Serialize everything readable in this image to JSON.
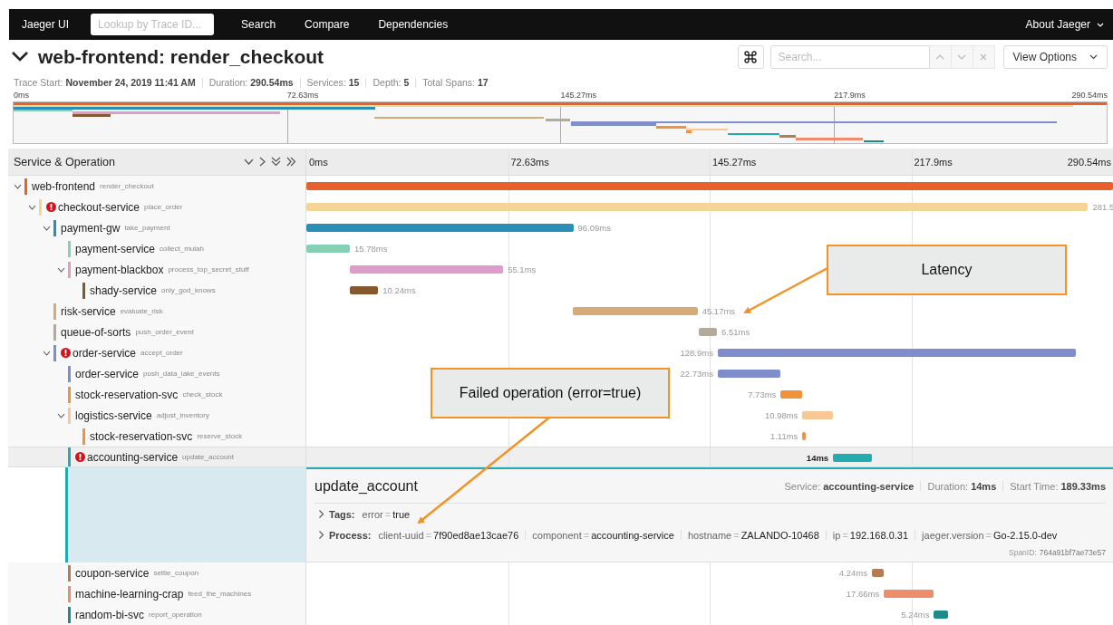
{
  "nav": {
    "brand": "Jaeger UI",
    "lookup_placeholder": "Lookup by Trace ID...",
    "links": [
      "Search",
      "Compare",
      "Dependencies"
    ],
    "about": "About Jaeger"
  },
  "trace": {
    "title": "web-frontend: render_checkout",
    "expanded": true,
    "search_placeholder": "Search...",
    "view_options": "View Options",
    "meta": [
      {
        "label": "Trace Start:",
        "value": "November 24, 2019 11:41 AM"
      },
      {
        "label": "Duration:",
        "value": "290.54ms"
      },
      {
        "label": "Services:",
        "value": "15"
      },
      {
        "label": "Depth:",
        "value": "5"
      },
      {
        "label": "Total Spans:",
        "value": "17"
      }
    ]
  },
  "minimap_ticks": [
    "0ms",
    "72.63ms",
    "145.27ms",
    "217.9ms",
    "290.54ms"
  ],
  "header": {
    "title": "Service & Operation",
    "ticks": [
      "0ms",
      "72.63ms",
      "145.27ms",
      "217.9ms",
      "290.54ms"
    ]
  },
  "spans": [
    {
      "service": "web-frontend",
      "operation": "render_checkout",
      "color": "#e8612c",
      "error": false,
      "expanded": true,
      "selected": false,
      "children": [
        {
          "service": "checkout-service",
          "operation": "place_order",
          "color": "#f5d597",
          "error": true,
          "expanded": true,
          "selected": false,
          "duration": "281.5",
          "children": [
            {
              "service": "payment-gw",
              "operation": "take_payment",
              "color": "#2a8fb6",
              "error": false,
              "expanded": true,
              "selected": false,
              "duration": "96.09ms",
              "children": [
                {
                  "service": "payment-service",
                  "operation": "collect_mulah",
                  "color": "#86d0b3",
                  "error": false,
                  "selected": false,
                  "duration": "15.78ms"
                },
                {
                  "service": "payment-blackbox",
                  "operation": "process_top_secret_stuff",
                  "color": "#dc9ec8",
                  "error": false,
                  "expanded": true,
                  "selected": false,
                  "duration": "55.1ms",
                  "children": [
                    {
                      "service": "shady-service",
                      "operation": "only_god_knows",
                      "color": "#86582f",
                      "error": false,
                      "selected": false,
                      "duration": "10.24ms"
                    }
                  ]
                }
              ]
            },
            {
              "service": "risk-service",
              "operation": "evaluate_risk",
              "color": "#d7ab77",
              "error": false,
              "selected": false,
              "duration": "45.17ms"
            },
            {
              "service": "queue-of-sorts",
              "operation": "push_order_event",
              "color": "#b2ab9c",
              "error": false,
              "selected": false,
              "duration": "6.51ms"
            },
            {
              "service": "order-service",
              "operation": "accept_order",
              "color": "#7f8dcb",
              "error": true,
              "expanded": true,
              "selected": false,
              "duration": "128.9ms",
              "children": [
                {
                  "service": "order-service",
                  "operation": "push_data_lake_events",
                  "color": "#7f8dcb",
                  "error": false,
                  "selected": false,
                  "duration": "22.73ms"
                },
                {
                  "service": "stock-reservation-svc",
                  "operation": "check_stock",
                  "color": "#f3913a",
                  "error": false,
                  "selected": false,
                  "duration": "7.73ms"
                },
                {
                  "service": "logistics-service",
                  "operation": "adjust_inventory",
                  "color": "#f8c796",
                  "error": false,
                  "expanded": true,
                  "selected": false,
                  "duration": "10.98ms",
                  "children": [
                    {
                      "service": "stock-reservation-svc",
                      "operation": "reserve_stock",
                      "color": "#f3913a",
                      "error": false,
                      "selected": false,
                      "duration": "1.11ms"
                    }
                  ]
                },
                {
                  "service": "accounting-service",
                  "operation": "update_account",
                  "color": "#24abb0",
                  "error": true,
                  "selected": true,
                  "duration": "14ms"
                },
                {
                  "service": "coupon-service",
                  "operation": "settle_coupon",
                  "color": "#b27c55",
                  "error": false,
                  "selected": false,
                  "duration": "4.24ms"
                },
                {
                  "service": "machine-learning-crap",
                  "operation": "feed_the_machines",
                  "color": "#ee8d6c",
                  "error": false,
                  "selected": false,
                  "duration": "17.66ms"
                },
                {
                  "service": "random-bi-svc",
                  "operation": "report_operation",
                  "color": "#1f8a8e",
                  "error": false,
                  "selected": false,
                  "duration": "5.24ms"
                }
              ]
            }
          ]
        }
      ]
    }
  ],
  "detail": {
    "operation": "update_account",
    "stats": [
      {
        "label": "Service:",
        "value": "accounting-service"
      },
      {
        "label": "Duration:",
        "value": "14ms"
      },
      {
        "label": "Start Time:",
        "value": "189.33ms"
      }
    ],
    "tags": {
      "label": "Tags:",
      "expanded": false,
      "items": [
        {
          "key": "error",
          "value": "true"
        }
      ]
    },
    "process": {
      "label": "Process:",
      "expanded": false,
      "items": [
        {
          "key": "client-uuid",
          "value": "7f90ed8ae13cae76"
        },
        {
          "key": "component",
          "value": "accounting-service"
        },
        {
          "key": "hostname",
          "value": "ZALANDO-10468"
        },
        {
          "key": "ip",
          "value": "192.168.0.31"
        },
        {
          "key": "jaeger.version",
          "value": "Go-2.15.0-dev"
        }
      ]
    },
    "equals": "=",
    "span_id_label": "SpanID:",
    "span_id": "764a91bf7ae73e57"
  },
  "callouts": [
    {
      "text": "Latency"
    },
    {
      "text": "Failed operation (error=true)"
    }
  ]
}
